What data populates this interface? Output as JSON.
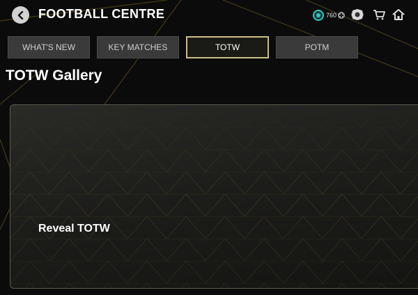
{
  "header": {
    "title": "FOOTBALL CENTRE",
    "back_icon": "chevron-left-icon",
    "currency": {
      "icon": "coin-icon",
      "amount": "760",
      "add_icon": "plus-circle-icon"
    },
    "icons": [
      "packs-icon",
      "cart-icon",
      "home-icon"
    ]
  },
  "tabs": [
    {
      "label": "WHAT'S NEW",
      "active": false
    },
    {
      "label": "KEY MATCHES",
      "active": false
    },
    {
      "label": "TOTW",
      "active": true
    },
    {
      "label": "POTM",
      "active": false
    }
  ],
  "section": {
    "heading": "TOTW Gallery"
  },
  "card": {
    "title": "Reveal TOTW"
  },
  "colors": {
    "background": "#0b0b0b",
    "tab_bg": "#3a3a3a",
    "active_tab_border": "#cbbf84",
    "accent_gold": "#8a7d3c",
    "coin_teal": "#2fc7c0"
  }
}
